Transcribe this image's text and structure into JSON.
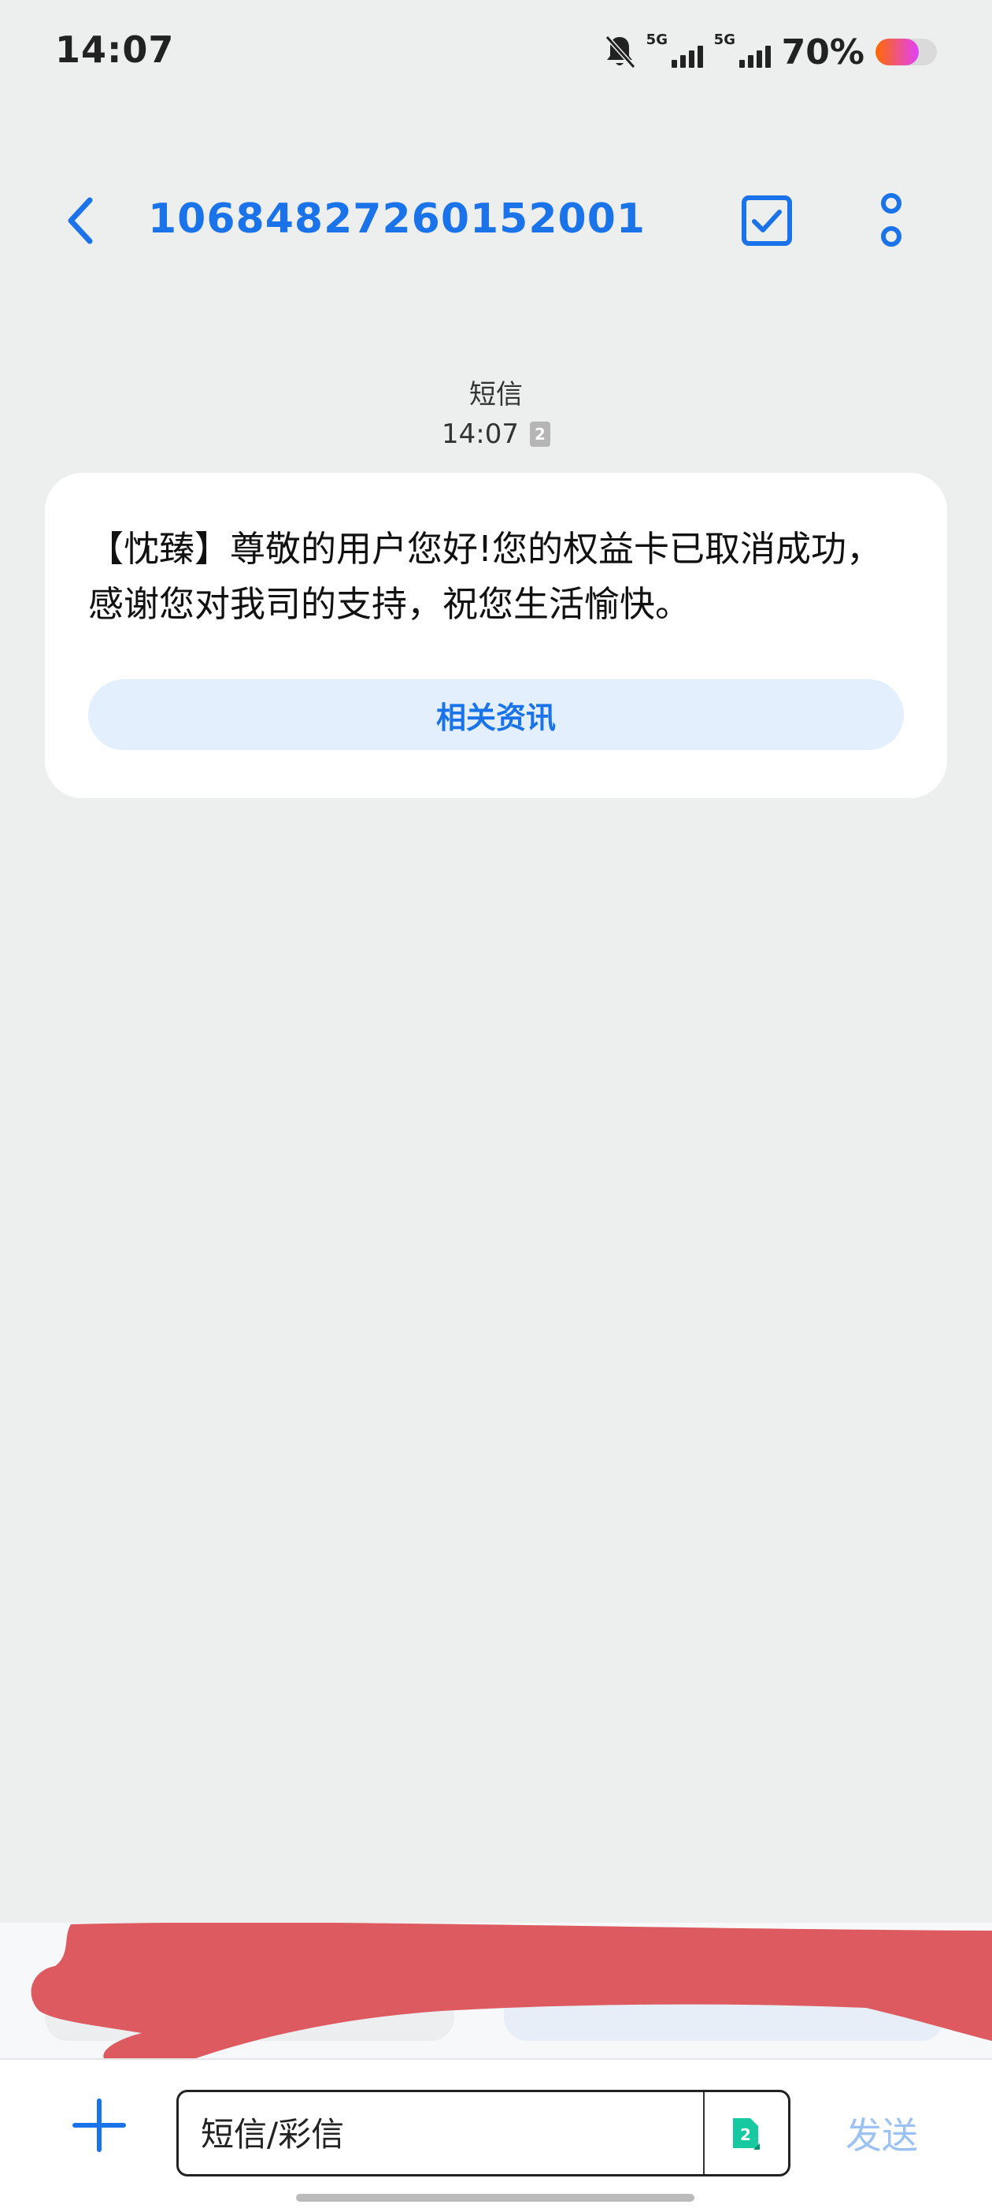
{
  "status_bar": {
    "time": "14:07",
    "network_label_1": "5G",
    "network_label_2": "5G",
    "battery_percent": "70%",
    "battery_level": 0.7,
    "icons": [
      "bell-muted-icon",
      "signal-icon",
      "signal-icon",
      "battery-icon"
    ]
  },
  "header": {
    "title": "10684827260152001",
    "back_icon": "chevron-left-icon",
    "select_icon": "checkbox-icon",
    "more_icon": "more-vertical-icon"
  },
  "message": {
    "type_label": "短信",
    "time": "14:07",
    "sim_slot": "2",
    "body": "【忱臻】尊敬的用户您好!您的权益卡已取消成功，感谢您对我司的支持，祝您生活愉快。",
    "action_label": "相关资讯"
  },
  "composer": {
    "placeholder": "短信/彩信",
    "sim_slot": "2",
    "send_label": "发送",
    "add_icon": "plus-icon"
  },
  "colors": {
    "accent": "#1A73E8",
    "background": "#EDEFEF",
    "bubble": "#FFFFFF",
    "chip": "#E3EFFC",
    "send_disabled": "#9CC2F2",
    "redaction": "#DD5A60"
  }
}
